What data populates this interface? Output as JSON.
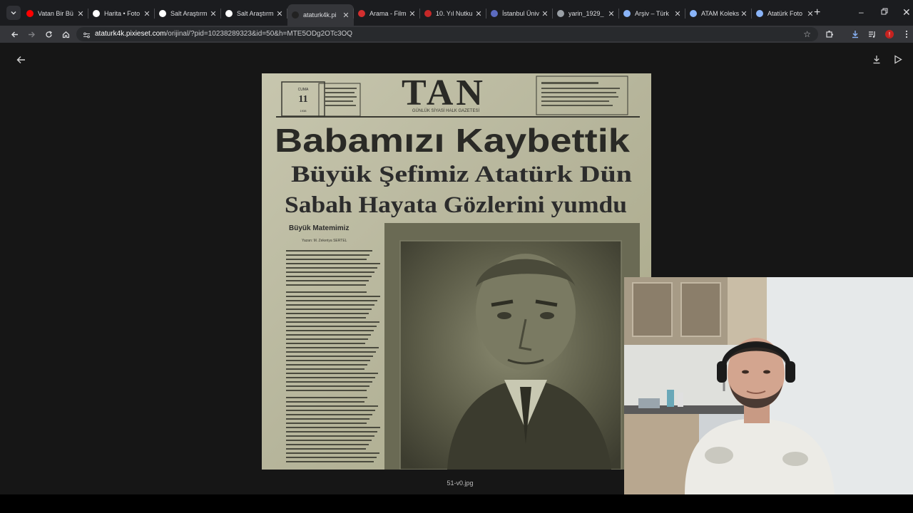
{
  "browser": {
    "tabs": [
      {
        "title": "Vatan Bir Bü",
        "icon": "youtube-icon",
        "color": "#ff0000",
        "active": false
      },
      {
        "title": "Harita • Foto",
        "icon": "site-icon",
        "color": "#ffffff",
        "active": false
      },
      {
        "title": "Salt Araştırm",
        "icon": "salt-icon",
        "color": "#ffffff",
        "active": false
      },
      {
        "title": "Salt Araştırm",
        "icon": "salt-icon",
        "color": "#ffffff",
        "active": false
      },
      {
        "title": "ataturk4k.pi",
        "icon": "pixieset-icon",
        "color": "#222222",
        "active": true
      },
      {
        "title": "Arama - Film",
        "icon": "red-site-icon",
        "color": "#d32f2f",
        "active": false
      },
      {
        "title": "10. Yıl Nutku",
        "icon": "red-site-icon",
        "color": "#c62828",
        "active": false
      },
      {
        "title": "İstanbul Üniv",
        "icon": "university-icon",
        "color": "#5c6bc0",
        "active": false
      },
      {
        "title": "yarin_1929_",
        "icon": "globe-icon",
        "color": "#9aa0a6",
        "active": false
      },
      {
        "title": "Arşiv – Türk",
        "icon": "archive-icon",
        "color": "#8ab4f8",
        "active": false
      },
      {
        "title": "ATAM Koleks",
        "icon": "archive-icon",
        "color": "#8ab4f8",
        "active": false
      },
      {
        "title": "Atatürk Foto",
        "icon": "archive-icon",
        "color": "#8ab4f8",
        "active": false
      }
    ],
    "url_host": "ataturk4k.pixieset.com",
    "url_rest": "/orijinal/?pid=10238289323&id=50&h=MTE5ODg2OTc3OQ",
    "profile_initial": "!"
  },
  "viewer": {
    "caption": "51-v0.jpg"
  },
  "newspaper": {
    "masthead": "TAN",
    "subtitle": "GÜNLÜK SİYASİ HALK GAZETESİ",
    "date_box": "CUMA 11 İKİNCİTEŞRİN 1938",
    "headline": "Babamızı Kaybettik",
    "subheadline_1": "Büyük Şefimiz Atatürk Dün",
    "subheadline_2": "Sabah Hayata Gözlerini yumdu",
    "section_title": "Büyük Matemimiz",
    "byline": "Yazan: M. Zekeriya SERTEL"
  },
  "colors": {
    "paper": "#b9b89f",
    "ink": "#2c2c2c",
    "viewer_bg": "#161616",
    "tab_active": "#35363a"
  }
}
